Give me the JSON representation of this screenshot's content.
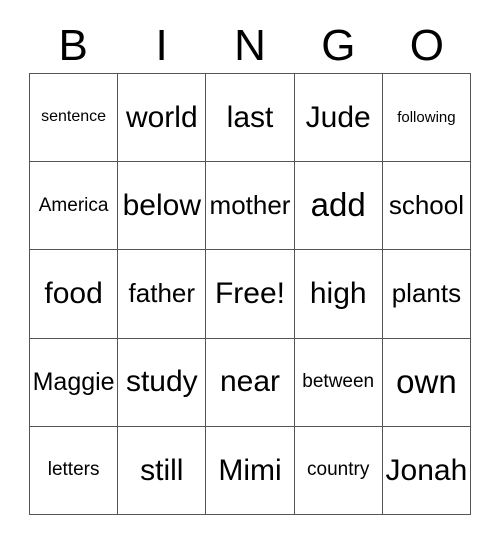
{
  "card": {
    "title": "BINGO",
    "header_letters": [
      "B",
      "I",
      "N",
      "G",
      "O"
    ],
    "free_space_label": "Free!",
    "colors": {
      "grid_line": "#555555",
      "text": "#000000",
      "background": "#ffffff"
    },
    "rows": [
      {
        "cells": [
          {
            "word": "sentence"
          },
          {
            "word": "world"
          },
          {
            "word": "last"
          },
          {
            "word": "Jude"
          },
          {
            "word": "following"
          }
        ]
      },
      {
        "cells": [
          {
            "word": "America"
          },
          {
            "word": "below"
          },
          {
            "word": "mother"
          },
          {
            "word": "add"
          },
          {
            "word": "school"
          }
        ]
      },
      {
        "cells": [
          {
            "word": "food"
          },
          {
            "word": "father"
          },
          {
            "word": "Free!"
          },
          {
            "word": "high"
          },
          {
            "word": "plants"
          }
        ]
      },
      {
        "cells": [
          {
            "word": "Maggie"
          },
          {
            "word": "study"
          },
          {
            "word": "near"
          },
          {
            "word": "between"
          },
          {
            "word": "own"
          }
        ]
      },
      {
        "cells": [
          {
            "word": "letters"
          },
          {
            "word": "still"
          },
          {
            "word": "Mimi"
          },
          {
            "word": "country"
          },
          {
            "word": "Jonah"
          }
        ]
      }
    ]
  }
}
